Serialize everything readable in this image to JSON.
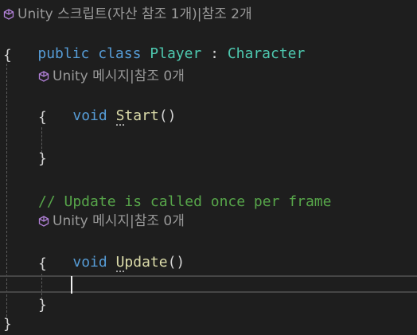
{
  "lenses": {
    "class_lens": {
      "icon": "unity-icon",
      "prefix": "Unity 스크립트(자산 참조 1개)",
      "sep": "|",
      "suffix": "참조 2개"
    },
    "start_lens": {
      "icon": "unity-icon",
      "prefix": "Unity 메시지",
      "sep": "|",
      "suffix": "참조 0개"
    },
    "update_lens": {
      "icon": "unity-icon",
      "prefix": "Unity 메시지",
      "sep": "|",
      "suffix": "참조 0개"
    }
  },
  "code": {
    "class_decl": {
      "kw_public": "public",
      "kw_class": "class",
      "class_name": "Player",
      "colon": ":",
      "base_class": "Character"
    },
    "open_brace_class": "{",
    "start_method": {
      "kw_void": "void",
      "name_first": "S",
      "name_rest": "tart",
      "parens": "()"
    },
    "open_brace_start": "{",
    "close_brace_start": "}",
    "comment": "// Update is called once per frame",
    "update_method": {
      "kw_void": "void",
      "name_first": "U",
      "name_rest": "pdate",
      "parens": "()"
    },
    "open_brace_update": "{",
    "close_brace_update": "}",
    "close_brace_class": "}"
  },
  "colors": {
    "background": "#1e1e1e",
    "keyword": "#569cd6",
    "type": "#4ec9b0",
    "method": "#dcdcaa",
    "comment": "#57a64a",
    "codelens": "#999999"
  }
}
